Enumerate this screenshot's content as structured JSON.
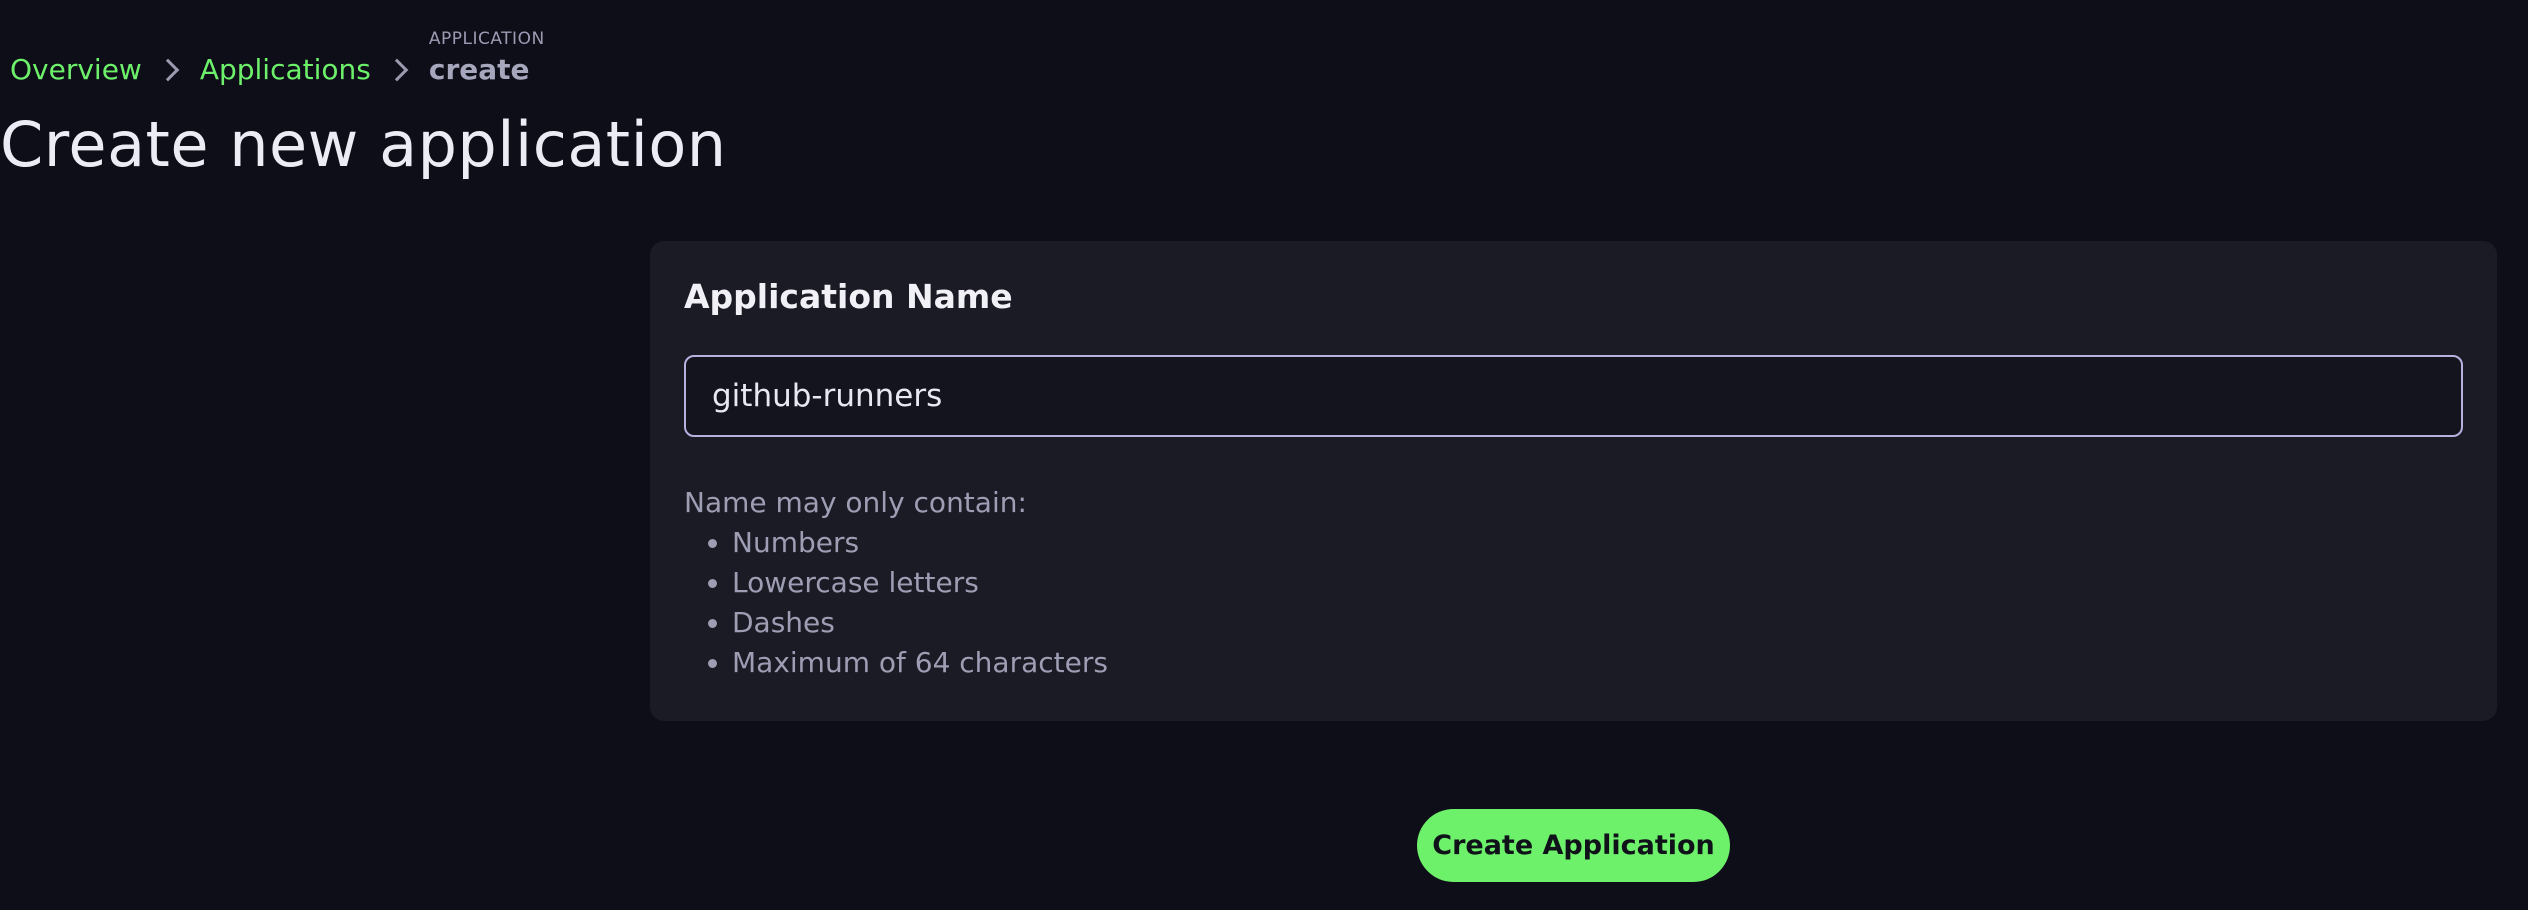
{
  "breadcrumb": {
    "items": [
      {
        "label": "Overview"
      },
      {
        "label": "Applications"
      }
    ],
    "current_kicker": "APPLICATION",
    "current_label": "create"
  },
  "header": {
    "title": "Create new application"
  },
  "form": {
    "name_label": "Application Name",
    "name_value": "github-runners",
    "rules_intro": "Name may only contain:",
    "rules": [
      "Numbers",
      "Lowercase letters",
      "Dashes",
      "Maximum of 64 characters"
    ],
    "submit_label": "Create Application"
  },
  "colors": {
    "background": "#0e0e18",
    "card": "#1b1b26",
    "accent": "#6df06a",
    "input_border": "#b6b2e0"
  },
  "icons": {
    "breadcrumb_separator": "chevron-right-icon"
  }
}
